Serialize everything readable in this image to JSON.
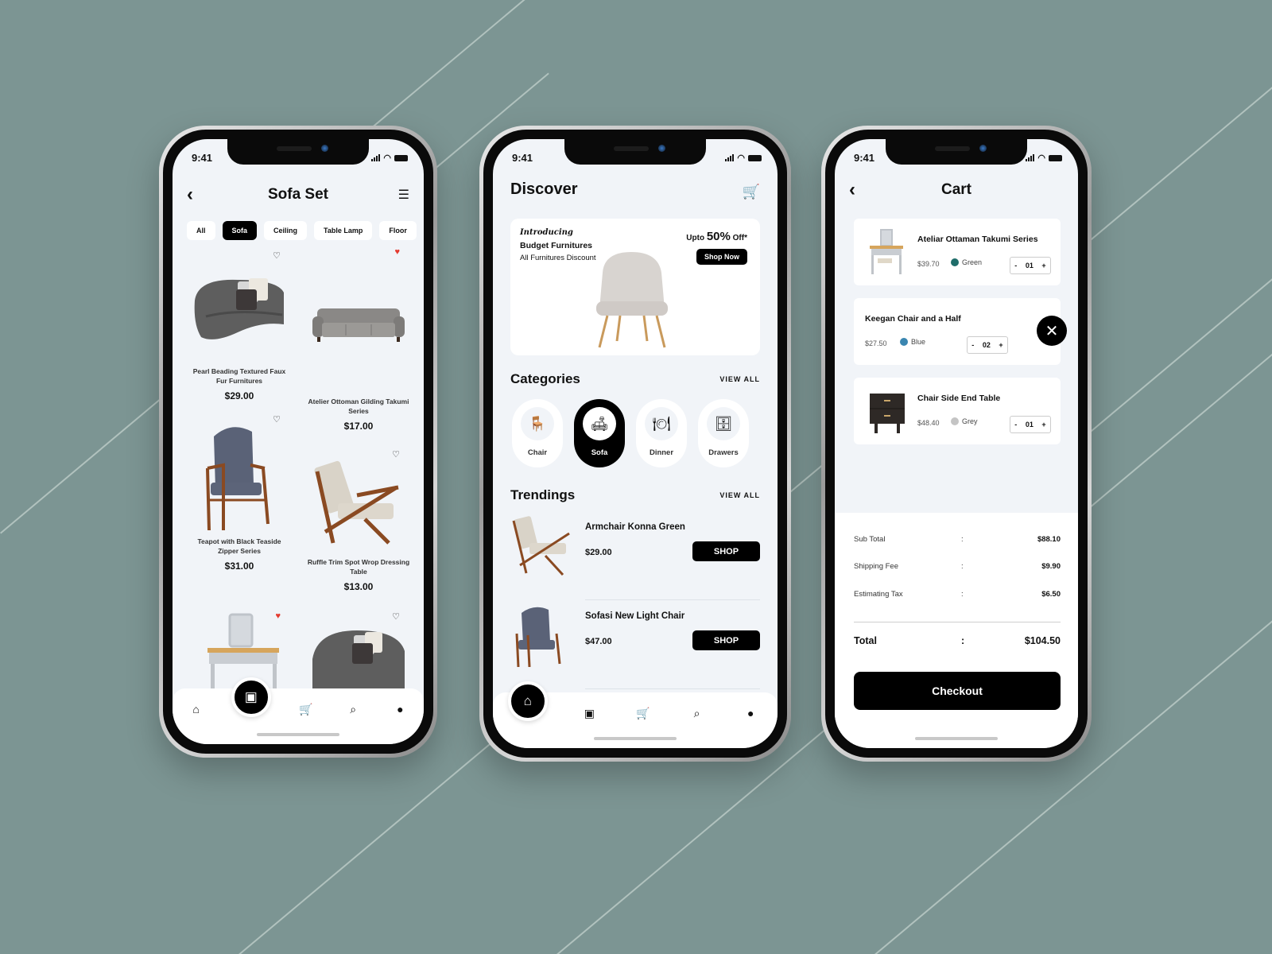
{
  "colors": {
    "background": "#7c9593",
    "screen_bg": "#f1f4f8",
    "primary": "#000000",
    "heart_active": "#e43a2f",
    "swatch_green": "#1f6d6a",
    "swatch_blue": "#3a86b0",
    "swatch_grey": "#c4c4c4"
  },
  "status_bar": {
    "time": "9:41"
  },
  "sofa_set_screen": {
    "title": "Sofa Set",
    "back_icon": "chevron-left-icon",
    "filter_icon": "sliders-icon",
    "chips": [
      {
        "label": "All",
        "active": false
      },
      {
        "label": "Sofa",
        "active": true
      },
      {
        "label": "Ceiling",
        "active": false
      },
      {
        "label": "Table Lamp",
        "active": false
      },
      {
        "label": "Floor",
        "active": false
      }
    ],
    "products": [
      {
        "name": "Pearl Beading Textured Faux Fur Furnitures",
        "price": "$29.00",
        "favorite": false
      },
      {
        "name": "Atelier Ottoman Gilding Takumi Series",
        "price": "$17.00",
        "favorite": true
      },
      {
        "name": "Teapot with Black Teaside Zipper Series",
        "price": "$31.00",
        "favorite": false
      },
      {
        "name": "Ruffle Trim Spot Wrop Dressing Table",
        "price": "$13.00",
        "favorite": false
      },
      {
        "name": "",
        "price": "",
        "favorite": true
      },
      {
        "name": "",
        "price": "",
        "favorite": false
      }
    ],
    "nav": [
      "home-icon",
      "box-icon",
      "cart-icon",
      "search-icon",
      "user-icon"
    ],
    "nav_active": "box-icon"
  },
  "discover_screen": {
    "title": "Discover",
    "banner": {
      "intro": "Introducing",
      "title": "Budget Furnitures",
      "subtitle": "All Furnitures Discount",
      "offer_prefix": "Upto",
      "offer_value": "50%",
      "offer_suffix": "Off*",
      "button": "Shop Now"
    },
    "categories_title": "Categories",
    "view_all": "VIEW ALL",
    "categories": [
      {
        "label": "Chair",
        "icon": "office-chair-icon",
        "glyph": "🪑",
        "active": false
      },
      {
        "label": "Sofa",
        "icon": "sofa-icon",
        "glyph": "🛋",
        "active": true
      },
      {
        "label": "Dinner",
        "icon": "dining-table-icon",
        "glyph": "🍽",
        "active": false
      },
      {
        "label": "Drawers",
        "icon": "drawers-icon",
        "glyph": "🗄",
        "active": false
      }
    ],
    "trendings_title": "Trendings",
    "trendings": [
      {
        "name": "Armchair Konna Green",
        "price": "$29.00",
        "button": "SHOP"
      },
      {
        "name": "Sofasi New Light Chair",
        "price": "$47.00",
        "button": "SHOP"
      }
    ],
    "nav": [
      "home-icon",
      "box-icon",
      "cart-icon",
      "search-icon",
      "user-icon"
    ],
    "nav_active": "home-icon"
  },
  "cart_screen": {
    "title": "Cart",
    "items": [
      {
        "name": "Ateliar Ottaman Takumi Series",
        "price": "$39.70",
        "color": "Green",
        "qty": "01"
      },
      {
        "name": "Keegan Chair and a Half",
        "price": "$27.50",
        "color": "Blue",
        "qty": "02"
      },
      {
        "name": "Chair Side End Table",
        "price": "$48.40",
        "color": "Grey",
        "qty": "01"
      }
    ],
    "qty_minus": "-",
    "qty_plus": "+",
    "summary": [
      {
        "label": "Sub Total",
        "sep": ":",
        "value": "$88.10"
      },
      {
        "label": "Shipping Fee",
        "sep": ":",
        "value": "$9.90"
      },
      {
        "label": "Estimating Tax",
        "sep": ":",
        "value": "$6.50"
      }
    ],
    "total": {
      "label": "Total",
      "sep": ":",
      "value": "$104.50"
    },
    "checkout_label": "Checkout"
  }
}
